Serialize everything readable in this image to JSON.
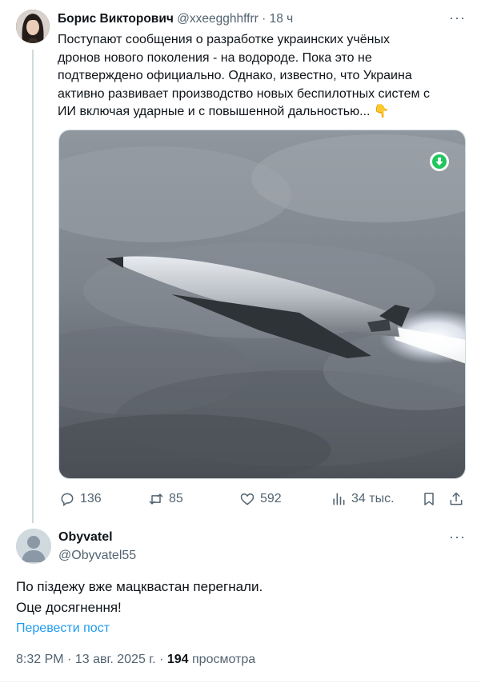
{
  "tweet": {
    "author_name": "Борис Викторович",
    "author_handle": "@xxeegghhffrr",
    "separator": "·",
    "time_ago": "18 ч",
    "more_label": "···",
    "text_lines": [
      "Поступают сообщения о разработке украинских учёных",
      "дронов нового поколения - на водороде. Пока это не",
      "подтверждено официально. Однако, известно, что Украина",
      "активно развивает производство новых беспилотных систем с",
      "ИИ включая ударные и с повышенной дальностью..."
    ],
    "emoji": "👇",
    "stats": {
      "replies": "136",
      "reposts": "85",
      "likes": "592",
      "views": "34 тыс."
    }
  },
  "reply": {
    "author_name": "Obyvatel",
    "author_handle": "@Obyvatel55",
    "more_label": "···",
    "text_line1": "По піздежу вже мацквастан перегнали.",
    "text_line2": "Оце досягнення!",
    "translate_label": "Перевести пост",
    "time": "8:32 PM",
    "dot": "·",
    "date": "13 авг. 2025 г.",
    "views_count": "194",
    "views_label": "просмотра"
  },
  "colors": {
    "accent": "#1d9bf0",
    "text": "#0f1419",
    "muted": "#536471",
    "border": "#cfd9de",
    "download_badge": "#22c55e"
  }
}
